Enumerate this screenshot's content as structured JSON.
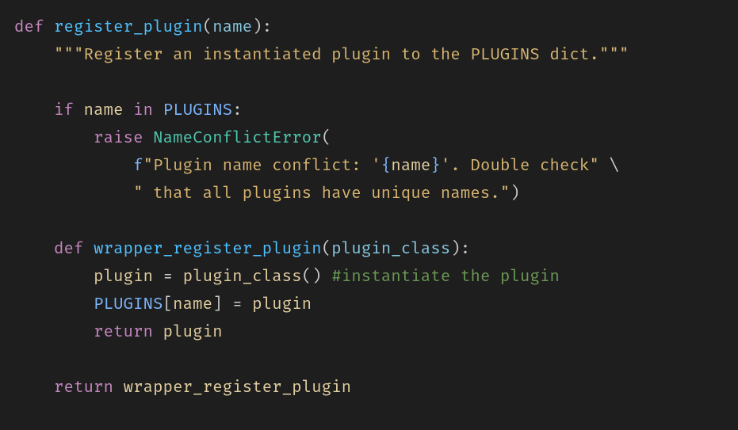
{
  "code": {
    "l1": {
      "def": "def",
      "fn": "register_plugin",
      "lp": "(",
      "p": "name",
      "rp": ")",
      "colon": ":"
    },
    "l2": {
      "doc": "\"\"\"Register an instantiated plugin to the PLUGINS dict.\"\"\""
    },
    "l4": {
      "if": "if",
      "v": "name",
      "in": "in",
      "c": "PLUGINS",
      "colon": ":"
    },
    "l5": {
      "raise": "raise",
      "err": "NameConflictError",
      "lp": "("
    },
    "l6": {
      "f": "f",
      "s": "\"Plugin name conflict: '",
      "lb": "{",
      "v": "name",
      "rb": "}",
      "s2": "'. Double check\"",
      "cont": "\\"
    },
    "l7": {
      "s": "\" that all plugins have unique names.\"",
      "rp": ")"
    },
    "l9": {
      "def": "def",
      "fn": "wrapper_register_plugin",
      "lp": "(",
      "p": "plugin_class",
      "rp": ")",
      "colon": ":"
    },
    "l10": {
      "v": "plugin",
      "eq": "=",
      "call": "plugin_class",
      "par": "()",
      "cmt": "#instantiate the plugin"
    },
    "l11": {
      "c": "PLUGINS",
      "lb": "[",
      "k": "name",
      "rb": "]",
      "eq": "=",
      "v": "plugin"
    },
    "l12": {
      "ret": "return",
      "v": "plugin"
    },
    "l14": {
      "ret": "return",
      "v": "wrapper_register_plugin"
    }
  }
}
